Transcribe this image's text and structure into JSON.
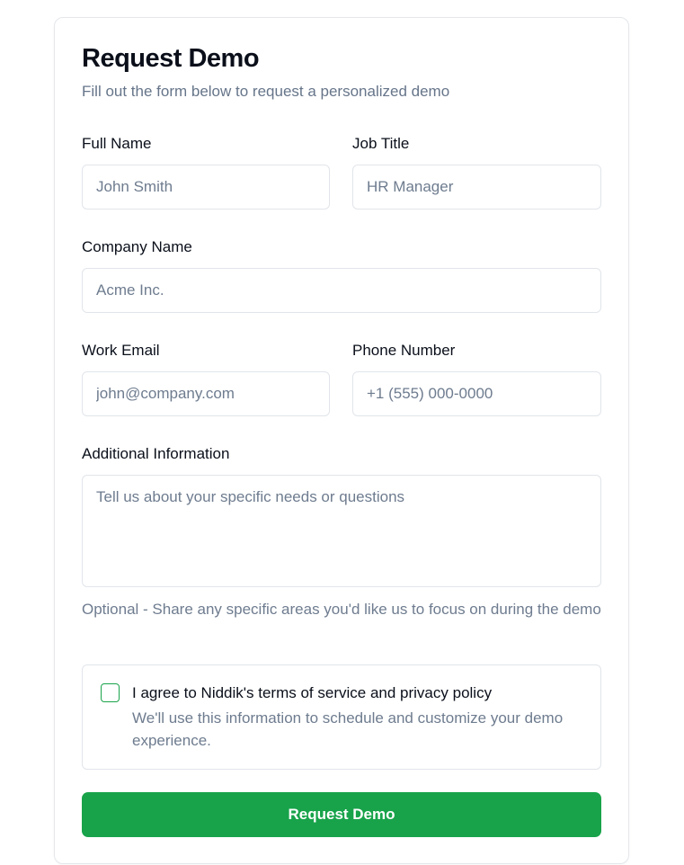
{
  "form": {
    "title": "Request Demo",
    "subtitle": "Fill out the form below to request a personalized demo",
    "full_name": {
      "label": "Full Name",
      "placeholder": "John Smith",
      "value": ""
    },
    "job_title": {
      "label": "Job Title",
      "placeholder": "HR Manager",
      "value": ""
    },
    "company_name": {
      "label": "Company Name",
      "placeholder": "Acme Inc.",
      "value": ""
    },
    "work_email": {
      "label": "Work Email",
      "placeholder": "john@company.com",
      "value": ""
    },
    "phone_number": {
      "label": "Phone Number",
      "placeholder": "+1 (555) 000-0000",
      "value": ""
    },
    "additional_info": {
      "label": "Additional Information",
      "placeholder": "Tell us about your specific needs or questions",
      "value": "",
      "help": "Optional - Share any specific areas you'd like us to focus on during the demo"
    },
    "consent": {
      "title": "I agree to Niddik's terms of service and privacy policy",
      "description": "We'll use this information to schedule and customize your demo experience.",
      "checked": false
    },
    "submit_label": "Request Demo"
  },
  "colors": {
    "accent": "#18a34a",
    "text": "#0a0f1a",
    "muted": "#6e7c8f",
    "border": "#e1e5ea"
  }
}
